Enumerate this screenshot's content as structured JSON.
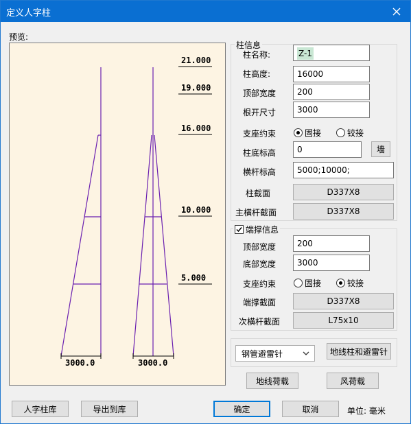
{
  "window": {
    "title": "定义人字柱"
  },
  "preview": {
    "label": "预览:",
    "elevations": [
      "21.000",
      "19.000",
      "16.000",
      "10.000",
      "5.000"
    ],
    "dimensions": [
      "3000.0",
      "3000.0"
    ]
  },
  "column_info": {
    "group_label": "柱信息",
    "name_label": "柱名称:",
    "name_value": "Z-1",
    "height_label": "柱高度:",
    "height_value": "16000",
    "top_width_label": "顶部宽度",
    "top_width_value": "200",
    "base_width_label": "根开尺寸",
    "base_width_value": "3000",
    "support_label": "支座约束",
    "support_options": [
      "固接",
      "铰接"
    ],
    "support_selected": "固接",
    "base_elev_label": "柱底标高",
    "base_elev_value": "0",
    "wall_button": "墙",
    "crossbar_elev_label": "横杆标高",
    "crossbar_elev_value": "5000;10000;",
    "section_label": "柱截面",
    "section_value": "D337X8",
    "main_crossbar_label": "主横杆截面",
    "main_crossbar_value": "D337X8"
  },
  "end_brace": {
    "group_label": "端撑信息",
    "checked": true,
    "top_width_label": "顶部宽度",
    "top_width_value": "200",
    "bottom_width_label": "底部宽度",
    "bottom_width_value": "3000",
    "support_label": "支座约束",
    "support_options": [
      "固接",
      "铰接"
    ],
    "support_selected": "铰接",
    "section_label": "端撑截面",
    "section_value": "D337X8",
    "secondary_crossbar_label": "次横杆截面",
    "secondary_crossbar_value": "L75x10"
  },
  "lightning": {
    "combo_value": "钢管避雷针",
    "button_label": "地线柱和避雷针"
  },
  "loads": {
    "ground_wire_button": "地线荷载",
    "wind_button": "风荷载"
  },
  "footer": {
    "library_button": "人字柱库",
    "export_button": "导出到库",
    "ok_button": "确定",
    "cancel_button": "取消",
    "unit_text": "单位: 毫米"
  }
}
